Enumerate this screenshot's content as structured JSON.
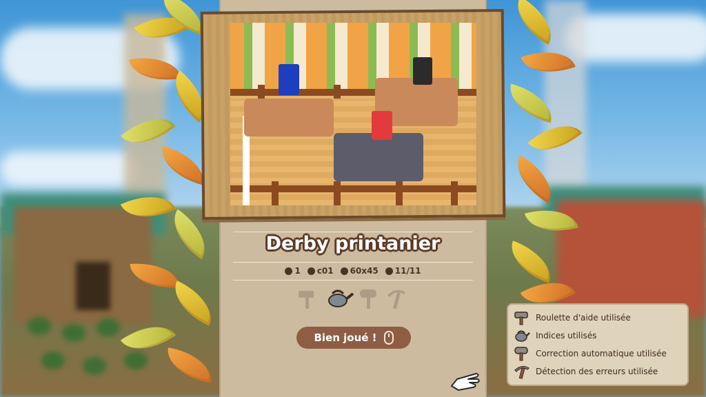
{
  "puzzle": {
    "title": "Derby printanier",
    "stats": [
      {
        "icon": "number-icon",
        "value": "1"
      },
      {
        "icon": "id-icon",
        "value": "c01"
      },
      {
        "icon": "size-icon",
        "value": "60x45"
      },
      {
        "icon": "count-icon",
        "value": "11/11"
      }
    ]
  },
  "tools": [
    {
      "name": "hammer-icon",
      "used": false
    },
    {
      "name": "watering-can-icon",
      "used": true
    },
    {
      "name": "mallet-icon",
      "used": false
    },
    {
      "name": "pickaxe-icon",
      "used": false
    }
  ],
  "button": {
    "label": "Bien joué !",
    "icon": "mouse-icon"
  },
  "legend": {
    "items": [
      {
        "icon": "hammer-icon",
        "label": "Roulette d'aide utilisée"
      },
      {
        "icon": "watering-can-icon",
        "label": "Indices utilisés"
      },
      {
        "icon": "mallet-icon",
        "label": "Correction automatique utilisée"
      },
      {
        "icon": "pickaxe-icon",
        "label": "Détection des erreurs utilisée"
      }
    ]
  },
  "colors": {
    "panel": "#cdbb9f",
    "button": "#8e5d44",
    "title_outline": "#5c3a26"
  }
}
